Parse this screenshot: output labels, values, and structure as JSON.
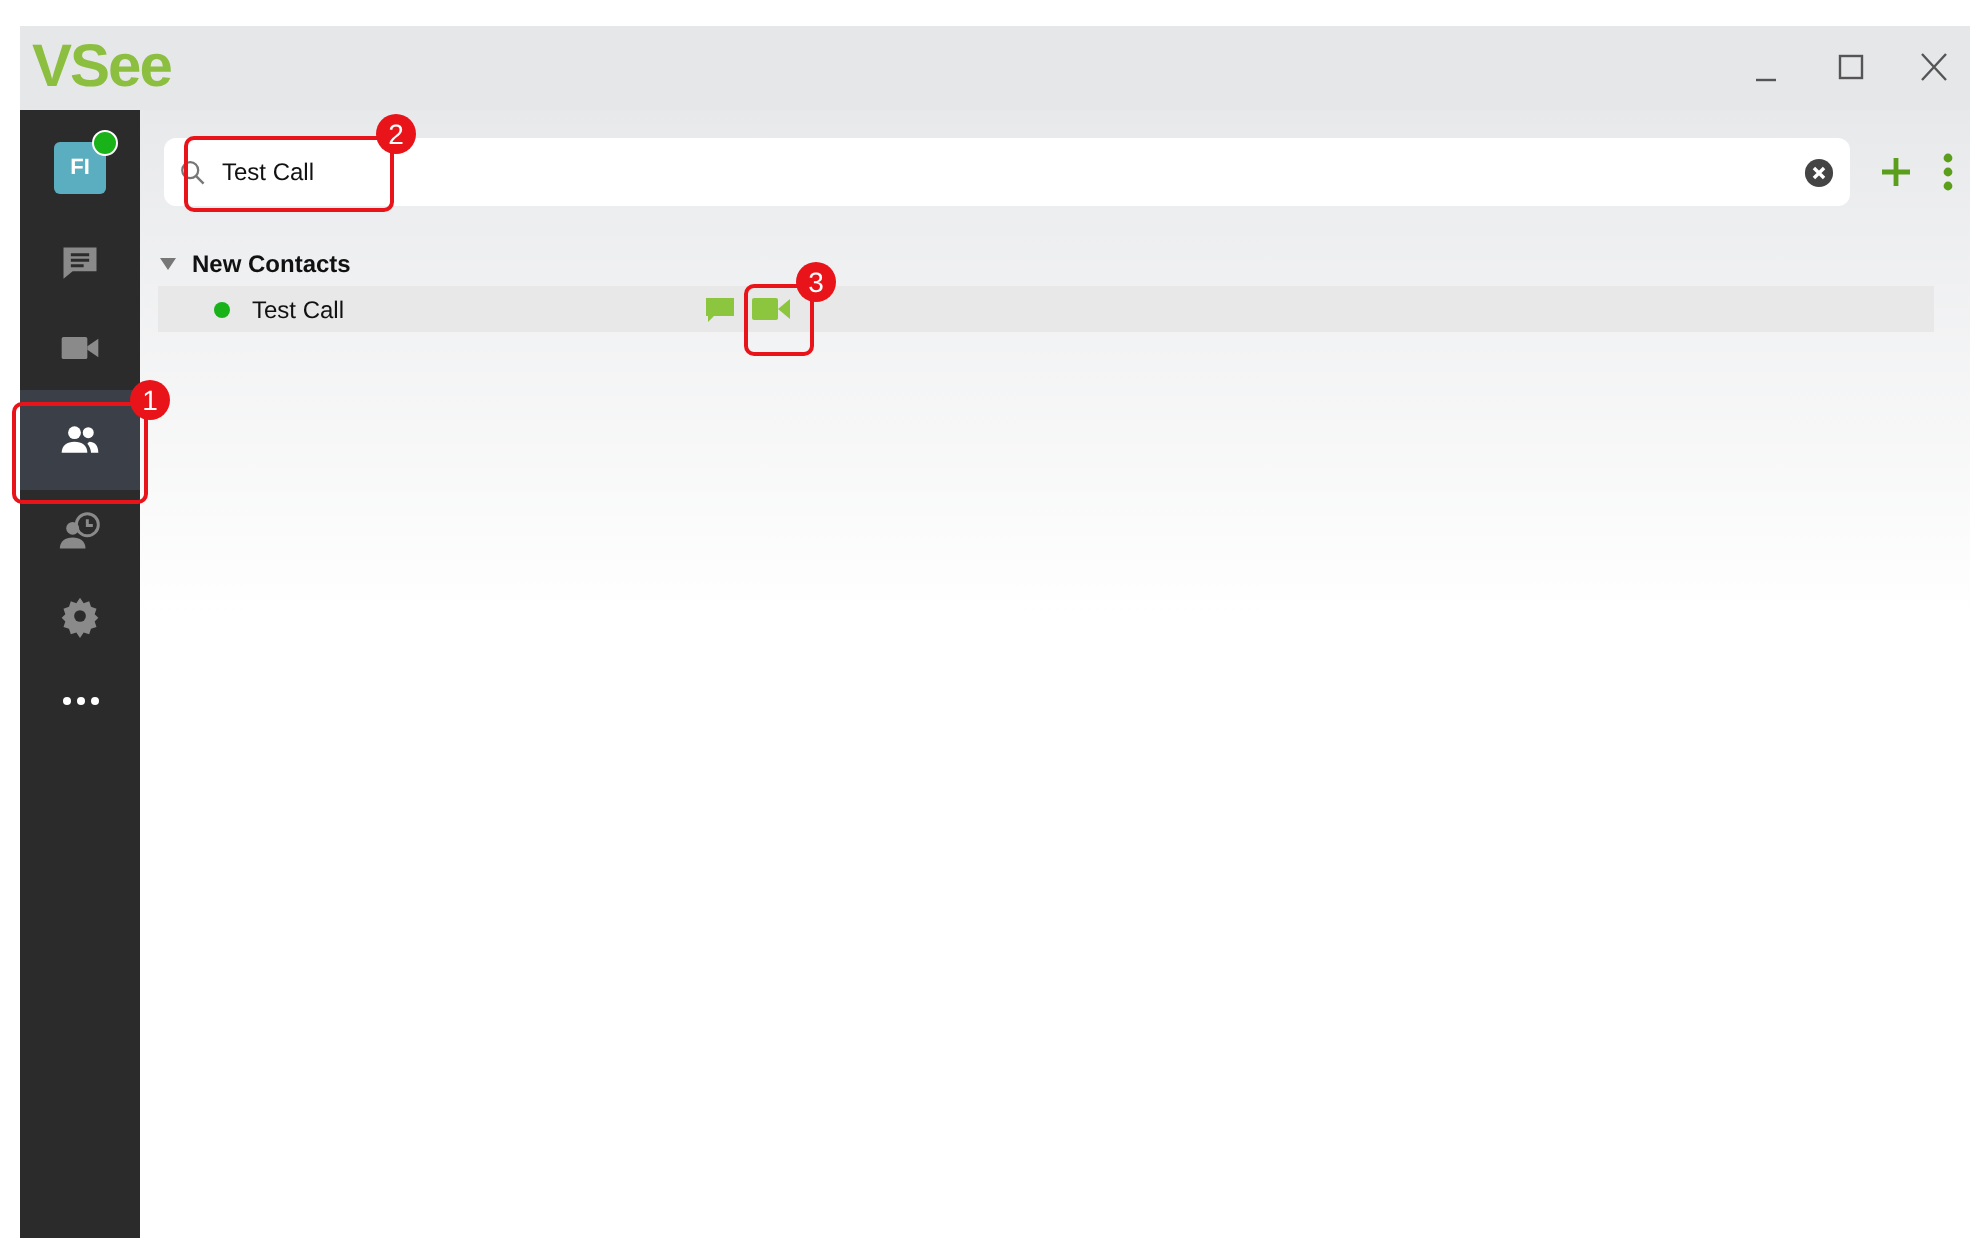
{
  "window": {
    "title": "VSee"
  },
  "account": {
    "initials": "FI",
    "online": true
  },
  "sidebar": {
    "items": [
      {
        "kind": "chat",
        "selected": false
      },
      {
        "kind": "video",
        "selected": false
      },
      {
        "kind": "contacts",
        "selected": true
      },
      {
        "kind": "history",
        "selected": false
      },
      {
        "kind": "settings",
        "selected": false
      },
      {
        "kind": "more",
        "selected": false
      }
    ]
  },
  "search": {
    "value": "Test Call"
  },
  "groups": [
    {
      "name": "New Contacts",
      "expanded": true,
      "contacts": [
        {
          "name": "Test Call",
          "online": true
        }
      ]
    }
  ],
  "annotations": [
    {
      "label": "1"
    },
    {
      "label": "2"
    },
    {
      "label": "3"
    }
  ]
}
